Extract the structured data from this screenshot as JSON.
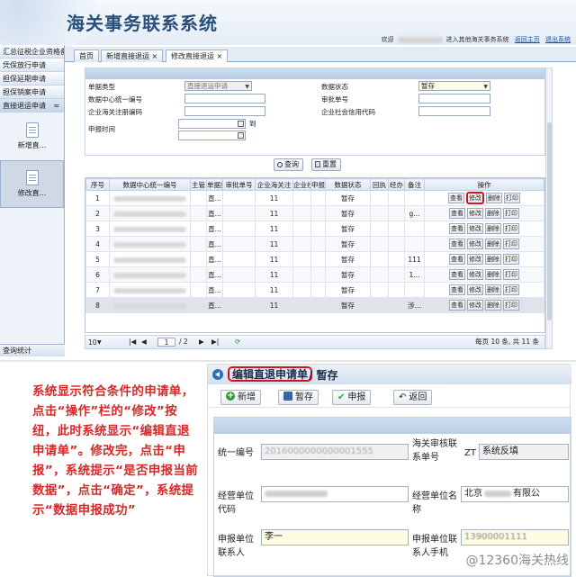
{
  "app": {
    "title": "海关事务联系系统",
    "welcome_prefix": "欢迎",
    "welcome_suffix": "进入其他海关事务系统",
    "link_home": "返回主页",
    "link_logout": "退出系统"
  },
  "sidebar": {
    "items": [
      "汇总征税企业资格备",
      "凭保放行申请",
      "担保延期申请",
      "担保销案申请",
      "直接退运申请"
    ],
    "collapse_glyph": "≈",
    "subitems": [
      "新增直...",
      "修改直..."
    ],
    "bottom": "查询统计"
  },
  "tabs": [
    {
      "label": "首页"
    },
    {
      "label": "新增直接退运",
      "close": "×"
    },
    {
      "label": "修改直接退运",
      "close": "×"
    }
  ],
  "search": {
    "labels": {
      "doc_type": "单据类型",
      "unified_no": "数据中心统一编号",
      "reg_code": "企业海关注册编码",
      "apply_time": "申报时间",
      "status": "数据状态",
      "approve_no": "审批单号",
      "credit_code": "企业社会信用代码",
      "to": "到"
    },
    "doc_type_value": "直接退运申请",
    "status_value": "暂存",
    "query_button": "查询",
    "reset_button": "重置"
  },
  "grid": {
    "columns": [
      "序号",
      "数据中心统一编号",
      "主管",
      "单据类",
      "审批单号",
      "企业海关注",
      "企业社",
      "申报",
      "数据状态",
      "回执",
      "经办",
      "备注",
      "操作"
    ],
    "rows": [
      {
        "no": "1",
        "type": "直...",
        "reg": "11",
        "status": "暂存",
        "note": ""
      },
      {
        "no": "2",
        "type": "直...",
        "reg": "11",
        "status": "暂存",
        "note": "g..."
      },
      {
        "no": "3",
        "type": "直...",
        "reg": "11",
        "status": "暂存",
        "note": ""
      },
      {
        "no": "4",
        "type": "直...",
        "reg": "11",
        "status": "暂存",
        "note": ""
      },
      {
        "no": "5",
        "type": "直...",
        "reg": "11",
        "status": "暂存",
        "note": "111"
      },
      {
        "no": "6",
        "type": "直...",
        "reg": "11",
        "status": "暂存",
        "note": "1..."
      },
      {
        "no": "7",
        "type": "直...",
        "reg": "11",
        "status": "暂存",
        "note": ""
      },
      {
        "no": "8",
        "type": "直...",
        "reg": "11",
        "status": "暂存",
        "note": "涉..."
      }
    ],
    "ops": {
      "view": "查看",
      "edit": "修改",
      "delete": "删除",
      "print": "打印"
    }
  },
  "pager": {
    "page_size": "10",
    "page": "1",
    "total_pages": "/ 2",
    "summary": "每页 10 条, 共 11 条"
  },
  "instruction": "系统显示符合条件的申请单，点击“操作”栏的“修改”按纽，此时系统显示“编辑直退申请单”。修改完，点击“申报”，系统提示“是否申报当前数据”，点击“确定”，系统提示“数据申报成功”",
  "edit_panel": {
    "title": "编辑直退申请单",
    "status_suffix": "/ 暂存",
    "buttons": {
      "add": "新增",
      "save": "暂存",
      "declare": "申报",
      "back": "返回"
    },
    "fields": {
      "unified_no_label": "统一编号",
      "unified_no_value": "2016000000000001555",
      "approve_no_label": "海关审核联系单号",
      "approve_no_prefix": "ZT",
      "approve_no_value": "系统反填",
      "op_code_label": "经营单位代码",
      "op_name_label": "经营单位名称",
      "op_name_value": "北京",
      "op_name_suffix": "有限公",
      "contact_label": "申报单位联系人",
      "contact_value": "李一",
      "phone_label": "申报单位联系人手机",
      "phone_value": "13900001111"
    }
  },
  "watermark": "@12360海关热线",
  "colors": {
    "accent": "#2a4f7a",
    "highlight": "#d2151c",
    "instruction": "#d42a2a"
  }
}
